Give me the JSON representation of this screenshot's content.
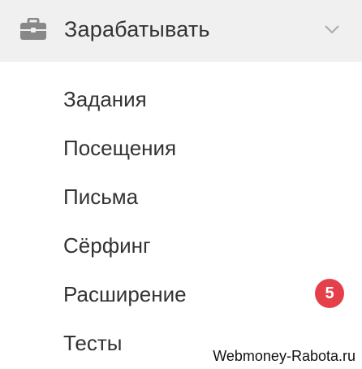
{
  "menu": {
    "section_title": "Зарабатывать",
    "section_icon": "briefcase-icon",
    "expand_icon": "chevron-down-icon",
    "items": [
      {
        "label": "Задания"
      },
      {
        "label": "Посещения"
      },
      {
        "label": "Письма"
      },
      {
        "label": "Сёрфинг"
      },
      {
        "label": "Расширение",
        "badge": "5"
      },
      {
        "label": "Тесты"
      }
    ]
  },
  "watermark": "Webmoney-Rabota.ru",
  "colors": {
    "header_background": "#f0f0f0",
    "text": "#333333",
    "icon": "#888888",
    "badge": "#e53f4a"
  }
}
